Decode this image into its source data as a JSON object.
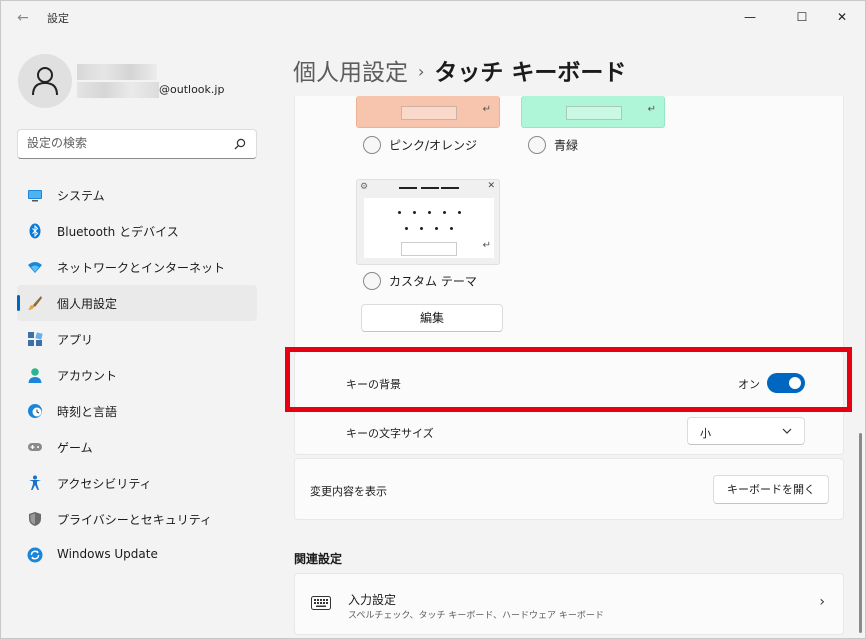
{
  "window": {
    "title": "設定",
    "back_glyph": "←",
    "minimize_glyph": "—",
    "maximize_glyph": "☐",
    "close_glyph": "✕"
  },
  "profile": {
    "email_suffix": "@outlook.jp"
  },
  "search": {
    "placeholder": "設定の検索"
  },
  "sidebar": {
    "items": [
      {
        "label": "システム",
        "icon": "monitor-icon"
      },
      {
        "label": "Bluetooth とデバイス",
        "icon": "bluetooth-icon"
      },
      {
        "label": "ネットワークとインターネット",
        "icon": "wifi-icon"
      },
      {
        "label": "個人用設定",
        "icon": "brush-icon",
        "active": true
      },
      {
        "label": "アプリ",
        "icon": "apps-icon"
      },
      {
        "label": "アカウント",
        "icon": "person-icon"
      },
      {
        "label": "時刻と言語",
        "icon": "clock-globe-icon"
      },
      {
        "label": "ゲーム",
        "icon": "gamepad-icon"
      },
      {
        "label": "アクセシビリティ",
        "icon": "accessibility-icon"
      },
      {
        "label": "プライバシーとセキュリティ",
        "icon": "shield-icon"
      },
      {
        "label": "Windows Update",
        "icon": "update-icon"
      }
    ]
  },
  "header": {
    "parent": "個人用設定",
    "separator": "›",
    "current": "タッチ キーボード"
  },
  "themes": {
    "pink_label": "ピンク/オレンジ",
    "green_label": "青緑",
    "custom_label": "カスタム テーマ",
    "enter_glyph": "↵",
    "gear_glyph": "⚙",
    "close_glyph": "✕",
    "edit_button": "編集"
  },
  "settings": {
    "key_background_label": "キーの背景",
    "key_background_state": "オン",
    "key_font_size_label": "キーの文字サイズ",
    "key_font_size_value": "小",
    "view_changes_label": "変更内容を表示",
    "open_keyboard_button": "キーボードを開く"
  },
  "related": {
    "title": "関連設定",
    "input_title": "入力設定",
    "input_subtitle": "スペルチェック、タッチ キーボード、ハードウェア キーボード",
    "arrow_glyph": "›"
  },
  "colors": {
    "accent": "#0067c0",
    "highlight": "#e60012",
    "pink_theme": "#f7c5ae",
    "green_theme": "#aff5d8"
  }
}
